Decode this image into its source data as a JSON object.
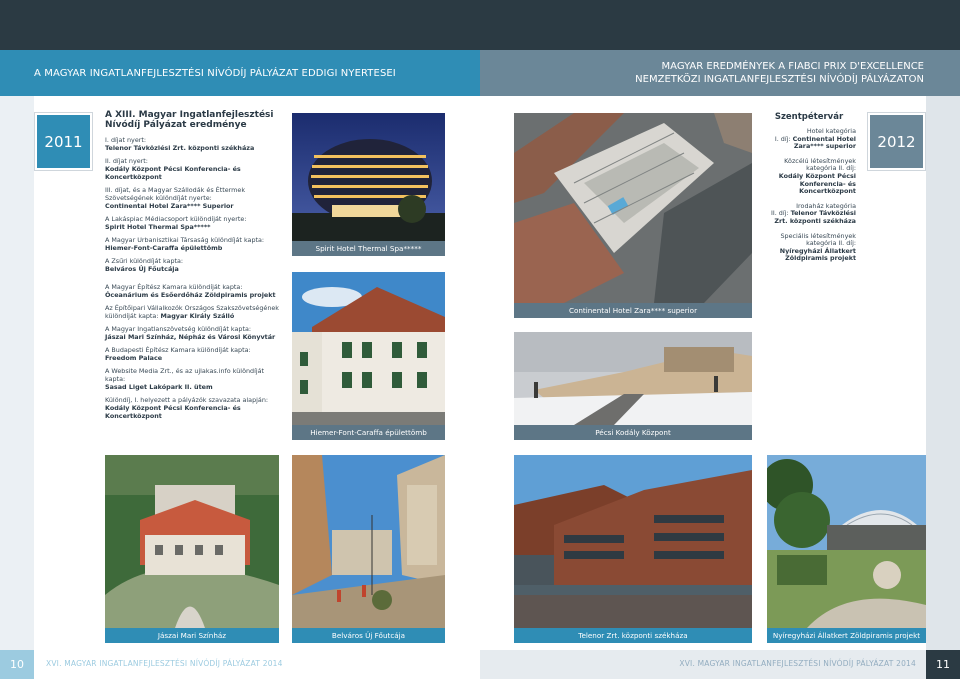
{
  "header": {
    "left_title": "A MAGYAR INGATLANFEJLESZTÉSI NÍVÓDÍJ PÁLYÁZAT EDDIGI NYERTESEI",
    "right_title_line1": "MAGYAR EREDMÉNYEK A FIABCI PRIX D'EXCELLENCE",
    "right_title_line2": "NEMZETKÖZI INGATLANFEJLESZTÉSI NÍVÓDÍJ PÁLYÁZATON"
  },
  "years": {
    "left": "2011",
    "right": "2012"
  },
  "left_column": {
    "title": "A XIII. Magyar Ingatlanfejlesztési Nívódíj Pályázat eredménye",
    "entries": [
      {
        "label": "I. díjat nyert:",
        "winner": "Telenor Távközlési Zrt. központi székháza"
      },
      {
        "label": "II. díjat nyert:",
        "winner": "Kodály Központ Pécsi Konferencia- és Koncertközpont"
      },
      {
        "label": "III. díjat, és a Magyar Szállodák és Éttermek Szövetségének különdíját nyerte:",
        "winner": "Continental Hotel Zara**** Superior"
      },
      {
        "label": "A Lakáspiac Médiacsoport különdíját nyerte:",
        "winner": "Spirit Hotel Thermal Spa*****"
      },
      {
        "label": "A Magyar Urbanisztikai Társaság különdíját kapta:",
        "winner": "Hiemer-Font-Caraffa épülettömb"
      },
      {
        "label": "A Zsűri különdíját kapta:",
        "winner": "Belváros Új Főutcája"
      },
      {
        "label": "A Magyar Építész Kamara különdíját kapta:",
        "winner": "Óceanárium és Esőerdőház Zöldpiramis projekt"
      },
      {
        "label": "Az Építőipari Vállalkozók Országos Szakszövetségének különdíját kapta: ",
        "winner": "Magyar Király Szálló",
        "inline": true
      },
      {
        "label": "A Magyar Ingatlanszövetség különdíját kapta:",
        "winner": "Jászai Mari Színház, Népház és Városi Könyvtár"
      },
      {
        "label": "A Budapesti Építész Kamara különdíját kapta:",
        "winner": "Freedom Palace"
      },
      {
        "label": "A Website Media Zrt., és az ujlakas.info különdíját kapta:",
        "winner": "Sasad Liget Lakópark II. ütem"
      },
      {
        "label": "Különdíj, I. helyezett a pályázók szavazata alapján:",
        "winner": "Kodály Központ Pécsi Konferencia- és Koncertközpont"
      }
    ]
  },
  "captions": {
    "spirit": "Spirit Hotel Thermal Spa*****",
    "continental": "Continental Hotel Zara**** superior",
    "hiemer": "Hiemer-Font-Caraffa épülettömb",
    "kodaly": "Pécsi Kodály Központ",
    "jaszai": "Jászai Mari Színház",
    "belvaros": "Belváros Új Főutcája",
    "telenor": "Telenor Zrt. központi székháza",
    "nyiregyhaza": "Nyíregyházi Állatkert Zöldpiramis projekt"
  },
  "right_column": {
    "title": "Szentpétervár",
    "categories": [
      {
        "category": "Hotel kategória",
        "prize": "I. díj: ",
        "winner": "Continental Hotel Zara**** superior"
      },
      {
        "category": "Közcélú létesítmények kategória II. díj:",
        "prize": "",
        "winner": "Kodály Központ Pécsi Konferencia- és Koncertközpont"
      },
      {
        "category": "Irodaház kategória",
        "prize": "II. díj: ",
        "winner": "Telenor Távközlési Zrt. központi székháza"
      },
      {
        "category": "Speciális létesítmények kategória II. díj:",
        "prize": "",
        "winner": "Nyíregyházi Állatkert Zöldpiramis projekt"
      }
    ]
  },
  "footer": {
    "left_page": "10",
    "right_page": "11",
    "left_text": "XVI. MAGYAR INGATLANFEJLESZTÉSI NÍVÓDÍJ PÁLYÁZAT 2014",
    "right_text": "XVI. MAGYAR INGATLANFEJLESZTÉSI NÍVÓDÍJ PÁLYÁZAT 2014"
  }
}
